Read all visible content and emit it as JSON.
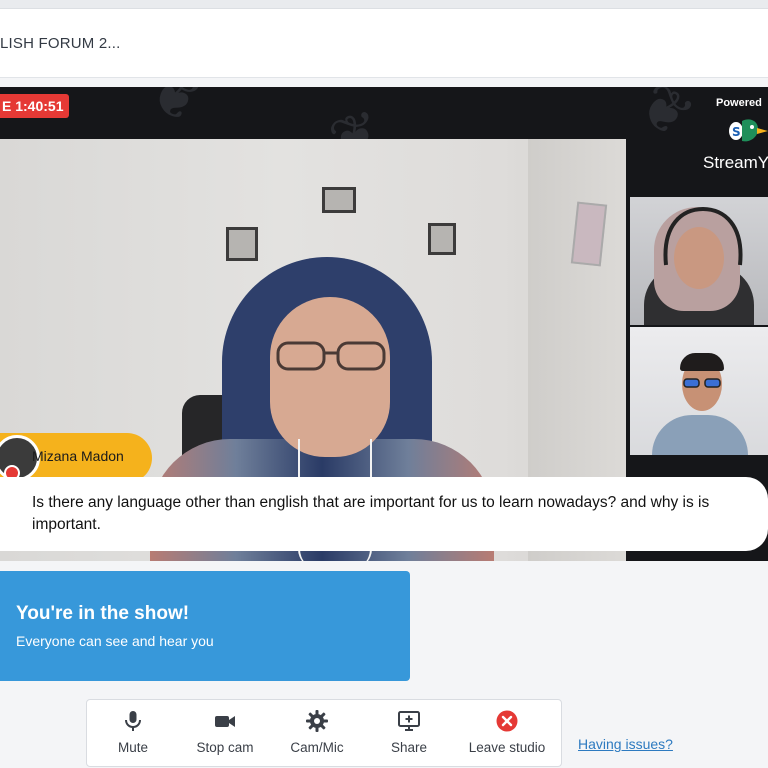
{
  "header": {
    "title": "LISH FORUM 2..."
  },
  "stage": {
    "live_timer": "E 1:40:51",
    "powered_by": "Powered",
    "logo_text": "StreamY",
    "speaker_name": "Mizana Madon",
    "caption": "Is there any language other than english that are important for us to learn nowadays? and why is is important."
  },
  "status_card": {
    "title": "You're in the show!",
    "subtitle": "Everyone can see and hear you"
  },
  "toolbar": {
    "mute_label": "Mute",
    "stop_cam_label": "Stop cam",
    "cam_mic_label": "Cam/Mic",
    "share_label": "Share",
    "leave_label": "Leave studio"
  },
  "help_link": "Having issues?",
  "colors": {
    "live_red": "#e53935",
    "name_tag_yellow": "#f5b21c",
    "show_card_blue": "#3798da",
    "leave_red": "#e53935",
    "link_blue": "#2d7ac0"
  },
  "icons": [
    "microphone-icon",
    "video-camera-icon",
    "gear-icon",
    "screen-share-icon",
    "leave-x-icon"
  ]
}
